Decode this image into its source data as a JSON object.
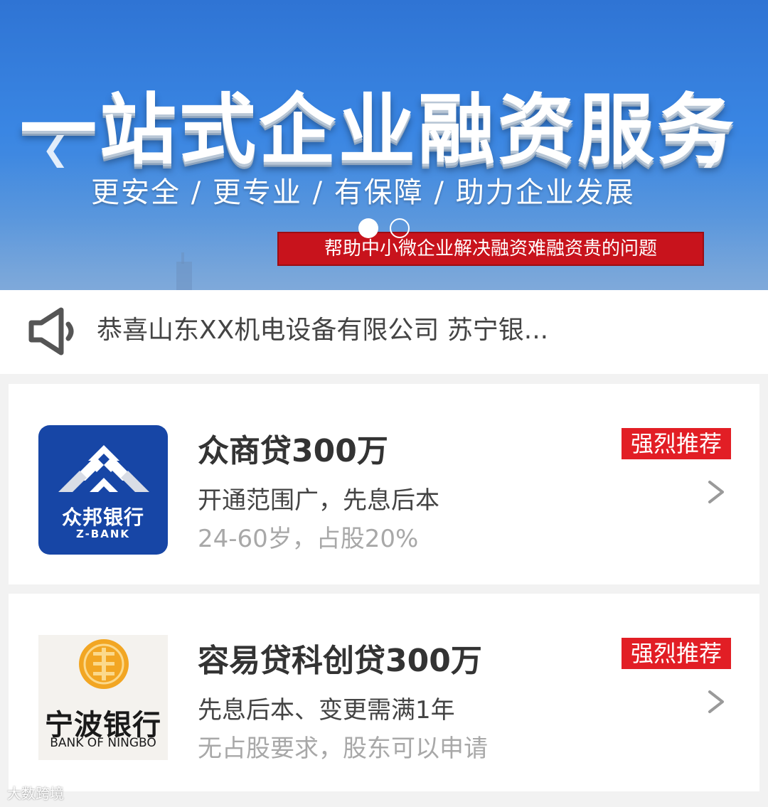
{
  "banner": {
    "title": "一站式企业融资服务",
    "subtitle": "更安全 / 更专业 / 有保障 / 助力企业发展",
    "strip": "帮助中小微企业解决融资难融资贵的问题",
    "prev_arrow": "❮",
    "next_arrow": "❯",
    "slide_count": 2,
    "active_slide": 1
  },
  "notice": {
    "icon": "speaker-icon",
    "text": "恭喜山东XX机电设备有限公司 苏宁银..."
  },
  "products": [
    {
      "bank_logo_cn": "众邦银行",
      "bank_logo_en": "Z-BANK",
      "title": "众商贷300万",
      "line1": "开通范围广，先息后本",
      "line2": "24-60岁，占股20%",
      "badge": "强烈推荐",
      "chevron_icon": "chevron-right-icon"
    },
    {
      "bank_logo_cn": "宁波银行",
      "bank_logo_en": "BANK OF NINGBO",
      "title": "容易贷科创贷300万",
      "line1": "先息后本、变更需满1年",
      "line2": "无占股要求，股东可以申请",
      "badge": "强烈推荐",
      "chevron_icon": "chevron-right-icon"
    }
  ],
  "watermark": "大数跨境",
  "colors": {
    "banner_blue": "#3a86e3",
    "strip_red": "#c8131c",
    "badge_red": "#e21e25",
    "zbank_blue": "#1746a6",
    "ningbo_orange": "#f2a623"
  }
}
